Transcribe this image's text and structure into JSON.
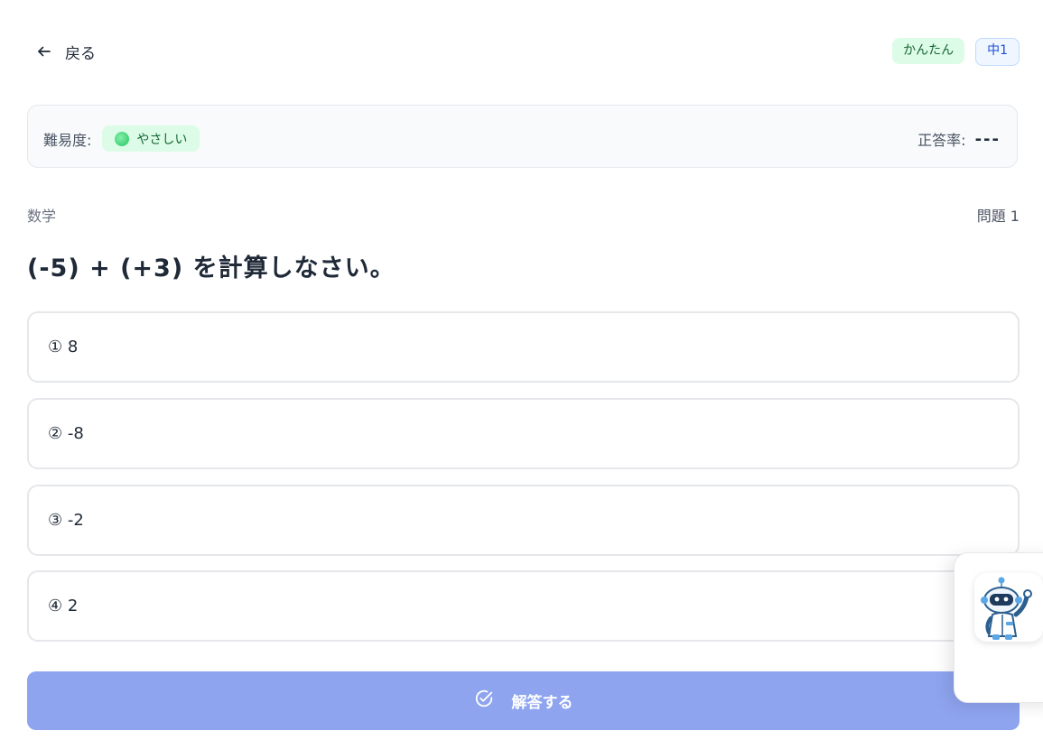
{
  "header": {
    "back_label": "戻る",
    "badge_level": "かんたん",
    "badge_grade": "中1"
  },
  "info": {
    "difficulty_label": "難易度:",
    "difficulty_value": "やさしい",
    "accuracy_label": "正答率:",
    "accuracy_value": "---"
  },
  "question": {
    "subject": "数学",
    "number": "問題 1",
    "text": "(-5) + (+3) を計算しなさい。",
    "options": [
      {
        "label": "① 8"
      },
      {
        "label": "② -8"
      },
      {
        "label": "③ -2"
      },
      {
        "label": "④ 2"
      }
    ]
  },
  "submit": {
    "label": "解答する"
  },
  "colors": {
    "submit_bg": "#8ea4ef",
    "easy_badge_bg": "#dcfce7",
    "grade_badge_bg": "#eff6ff"
  },
  "icons": {
    "back": "arrow-left-icon",
    "submit": "check-circle-icon",
    "difficulty": "green-dot-icon",
    "mascot": "robot-mascot-icon"
  }
}
